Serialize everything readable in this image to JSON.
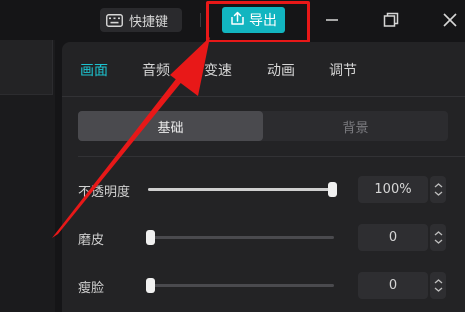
{
  "titlebar": {
    "shortcut_label": "快捷键",
    "export_label": "导出"
  },
  "tabs": [
    "画面",
    "音频",
    "变速",
    "动画",
    "调节"
  ],
  "active_tab": "画面",
  "segment": {
    "basic": "基础",
    "background": "背景"
  },
  "rows": [
    {
      "label": "不透明度",
      "value": "100%",
      "level": 1.0
    },
    {
      "label": "磨皮",
      "value": "0",
      "level": 0.0
    },
    {
      "label": "瘦脸",
      "value": "0",
      "level": 0.0
    }
  ],
  "colors": {
    "accent": "#12b5c0",
    "active_tab": "#1cc3d0",
    "annotation": "#e81818",
    "background": "#151517",
    "panel": "#232325"
  },
  "icons": {
    "shortcut": "keyboard-icon",
    "export": "export-upload-icon",
    "minimize": "minimize-icon",
    "maximize": "restore-window-icon",
    "close": "close-icon",
    "stepper": "chevron-up-down-icon"
  }
}
